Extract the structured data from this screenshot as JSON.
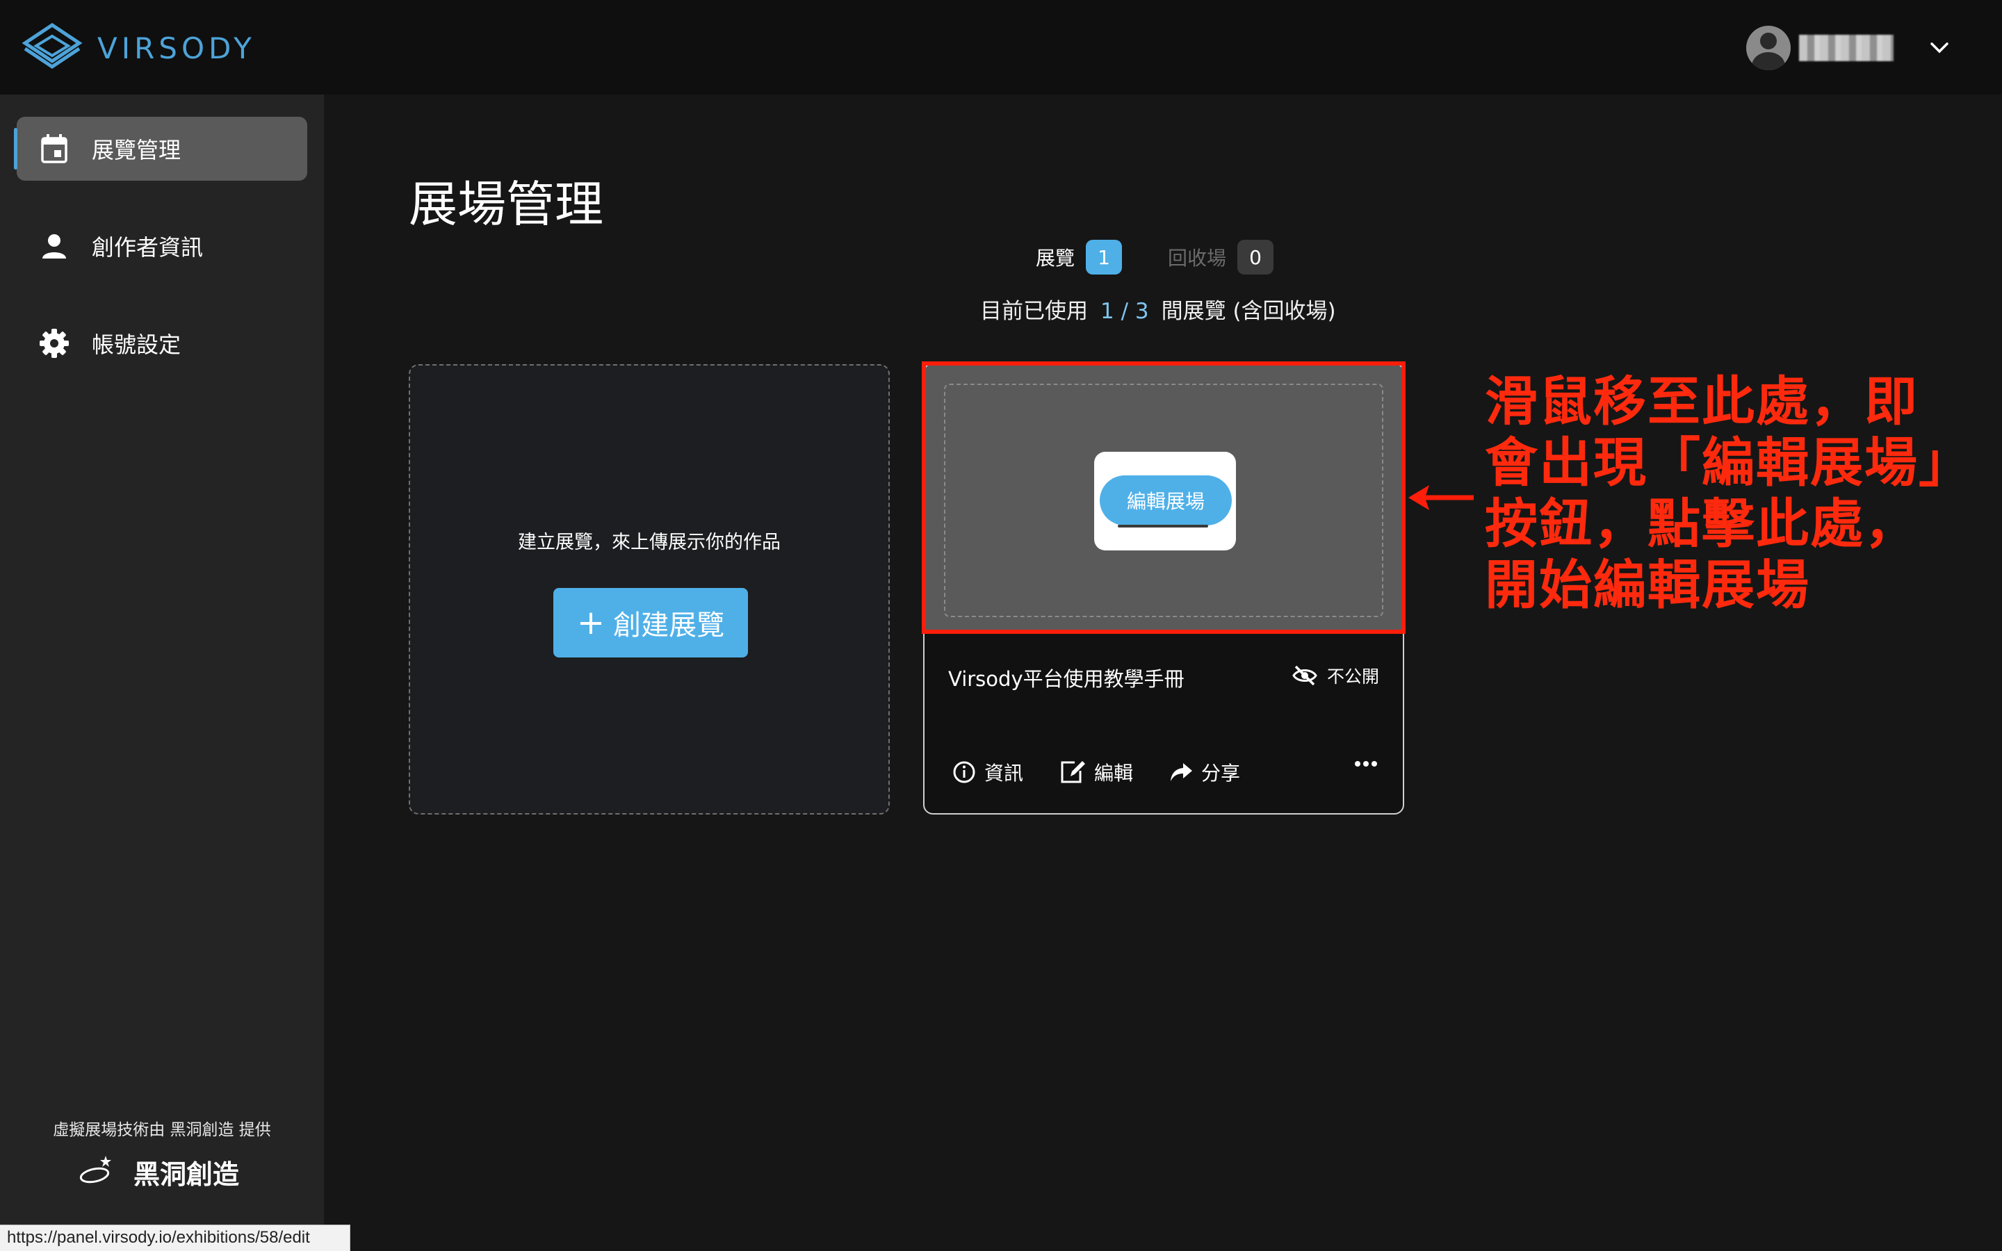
{
  "brand": {
    "name": "VIRSODY",
    "color": "#4da3d9"
  },
  "user": {
    "avatar_icon": "user-avatar-icon",
    "menu_icon": "chevron-down-icon"
  },
  "sidebar": {
    "items": [
      {
        "label": "展覽管理",
        "icon": "calendar-icon",
        "active": true
      },
      {
        "label": "創作者資訊",
        "icon": "person-icon",
        "active": false
      },
      {
        "label": "帳號設定",
        "icon": "gear-icon",
        "active": false
      }
    ],
    "powered_by": "虛擬展場技術由 黑洞創造 提供",
    "partner_name": "黑洞創造"
  },
  "main": {
    "title": "展場管理",
    "tabs": [
      {
        "label": "展覽",
        "count": "1",
        "active": true
      },
      {
        "label": "回收場",
        "count": "0",
        "active": false
      }
    ],
    "usage": {
      "prefix": "目前已使用",
      "value": "1 / 3",
      "suffix": "間展覽 (含回收場)"
    },
    "create_card": {
      "hint": "建立展覽，來上傳展示你的作品",
      "button_label": "創建展覽",
      "button_plus": "+"
    },
    "exhibition_card": {
      "edit_venue_label": "編輯展場",
      "title": "Virsody平台使用教學手冊",
      "visibility": "不公開",
      "actions": [
        {
          "label": "資訊",
          "icon": "info-icon"
        },
        {
          "label": "編輯",
          "icon": "edit-icon"
        },
        {
          "label": "分享",
          "icon": "share-icon"
        }
      ],
      "more_icon": "more-horizontal-icon"
    }
  },
  "annotation": {
    "text": "滑鼠移至此處，即會出現「編輯展場」按鈕，點擊此處，開始編輯展場",
    "color": "#ff1e0a"
  },
  "statusbar": {
    "url": "https://panel.virsody.io/exhibitions/58/edit"
  },
  "colors": {
    "accent": "#4fb0e8",
    "sidebar_bg": "#242424",
    "page_bg": "#161616"
  }
}
